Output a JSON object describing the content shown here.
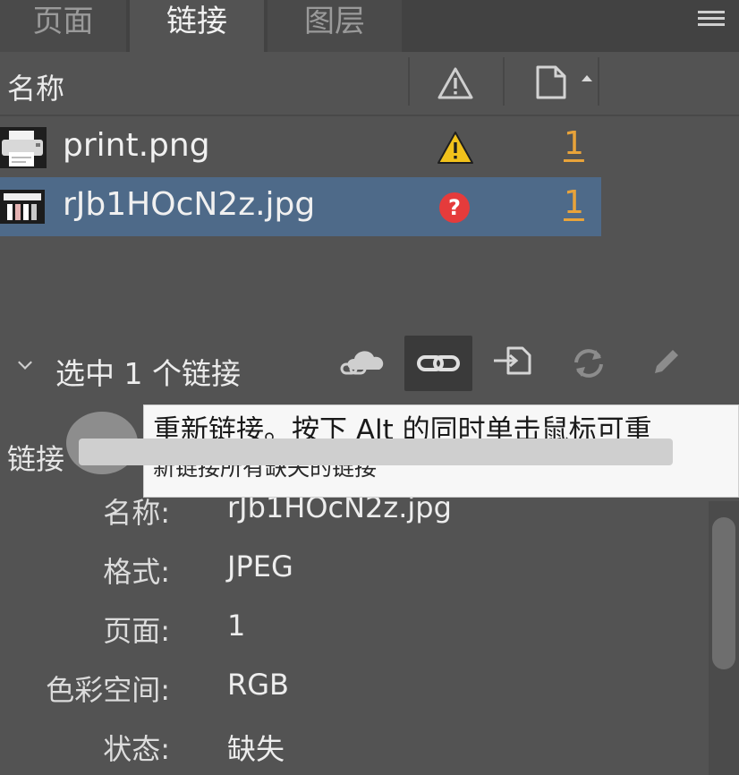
{
  "tabs": [
    {
      "label": "页面",
      "active": false
    },
    {
      "label": "链接",
      "active": true
    },
    {
      "label": "图层",
      "active": false
    }
  ],
  "menu_icon": "hamburger-menu-icon",
  "columns": {
    "name": "名称",
    "status_icon": "warning-triangle-icon",
    "page_icon": "page-document-icon",
    "sort": "ascending"
  },
  "links": [
    {
      "name": "print.png",
      "status": "warning",
      "status_icon": "warning-triangle-icon",
      "page": "1",
      "selected": false
    },
    {
      "name": "rJb1HOcN2z.jpg",
      "status": "missing",
      "status_icon": "missing-question-icon",
      "page": "1",
      "selected": true
    }
  ],
  "selection": {
    "title": "选中 1 个链接",
    "tools": [
      "cc-library-link-icon",
      "relink-icon",
      "goto-link-icon",
      "update-link-icon",
      "edit-original-icon"
    ]
  },
  "tooltip": {
    "line1": "重新链接。按下 Alt 的同时单击鼠标可重",
    "line2": "新链接所有缺失的链接"
  },
  "info": {
    "header_label": "链接",
    "rows": [
      {
        "key": "名称:",
        "value": "rJb1HOcN2z.jpg"
      },
      {
        "key": "格式:",
        "value": "JPEG"
      },
      {
        "key": "页面:",
        "value": "1"
      },
      {
        "key": "色彩空间:",
        "value": "RGB"
      },
      {
        "key": "状态:",
        "value": "缺失"
      }
    ]
  },
  "colors": {
    "panel_bg": "#535353",
    "selected_row": "#4e6a89",
    "warning": "#f2c21b",
    "missing": "#e53b3b",
    "page_link": "#e8a33a",
    "tooltip_bg": "#f7f7f7"
  }
}
